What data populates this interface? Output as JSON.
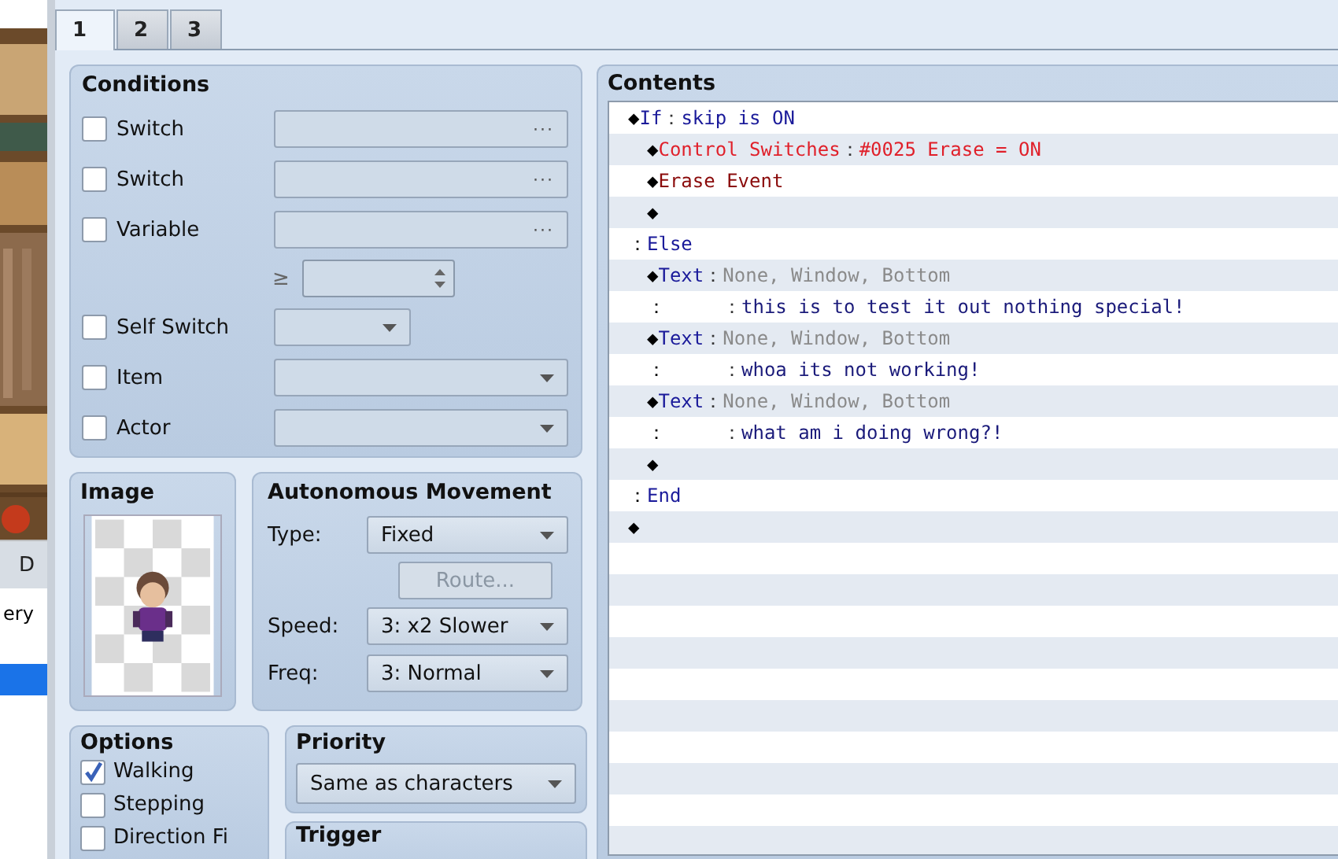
{
  "sidebar": {
    "tab_label": "D",
    "list_items": [
      {
        "label": "ery",
        "selected": false
      },
      {
        "selected": true
      }
    ]
  },
  "tabs": [
    {
      "label": "1",
      "selected": true
    },
    {
      "label": "2",
      "selected": false
    },
    {
      "label": "3",
      "selected": false
    }
  ],
  "conditions": {
    "title": "Conditions",
    "rows": [
      {
        "kind": "picker",
        "label": "Switch",
        "checked": false,
        "button": "···"
      },
      {
        "kind": "picker",
        "label": "Switch",
        "checked": false,
        "button": "···"
      },
      {
        "kind": "picker",
        "label": "Variable",
        "checked": false,
        "button": "···"
      },
      {
        "kind": "compare",
        "symbol": "≥"
      },
      {
        "kind": "short-dropdown",
        "label": "Self Switch",
        "checked": false
      },
      {
        "kind": "dropdown",
        "label": "Item",
        "checked": false
      },
      {
        "kind": "dropdown",
        "label": "Actor",
        "checked": false
      }
    ]
  },
  "image": {
    "title": "Image"
  },
  "movement": {
    "title": "Autonomous Movement",
    "fields": [
      {
        "kind": "dropdown",
        "label": "Type:",
        "value": "Fixed"
      },
      {
        "kind": "button",
        "value": "Route...",
        "disabled": true
      },
      {
        "kind": "dropdown",
        "label": "Speed:",
        "value": "3: x2 Slower"
      },
      {
        "kind": "dropdown",
        "label": "Freq:",
        "value": "3: Normal"
      }
    ]
  },
  "options": {
    "title": "Options",
    "items": [
      {
        "label": "Walking",
        "checked": true
      },
      {
        "label": "Stepping",
        "checked": false
      },
      {
        "label": "Direction Fi",
        "checked": false
      }
    ]
  },
  "priority": {
    "title": "Priority",
    "value": "Same as characters"
  },
  "trigger": {
    "title": "Trigger"
  },
  "contents": {
    "title": "Contents",
    "rows": [
      {
        "marker": "◆",
        "segments": [
          {
            "kind": "command",
            "text": "If"
          },
          {
            "kind": "sep",
            "text": "："
          },
          {
            "kind": "command",
            "text": "skip is ON"
          }
        ],
        "children": [
          {
            "marker": "◆",
            "segments": [
              {
                "kind": "switch",
                "text": "Control Switches"
              },
              {
                "kind": "sep",
                "text": "："
              },
              {
                "kind": "switch",
                "text": "#0025 Erase = ON"
              }
            ]
          },
          {
            "marker": "◆",
            "segments": [
              {
                "kind": "erase",
                "text": "Erase Event"
              }
            ]
          },
          {
            "marker": "◆"
          }
        ]
      },
      {
        "marker": "：",
        "segments": [
          {
            "kind": "command",
            "text": "Else"
          }
        ],
        "children": [
          {
            "marker": "◆",
            "segments": [
              {
                "kind": "command",
                "text": "Text"
              },
              {
                "kind": "sep",
                "text": "："
              },
              {
                "kind": "param",
                "text": "None, Window, Bottom"
              }
            ]
          },
          {
            "marker": "：",
            "segments": [
              {
                "kind": "wide-sep",
                "text": "："
              },
              {
                "kind": "message",
                "text": "this is to test it out nothing special!"
              }
            ]
          },
          {
            "marker": "◆",
            "segments": [
              {
                "kind": "command",
                "text": "Text"
              },
              {
                "kind": "sep",
                "text": "："
              },
              {
                "kind": "param",
                "text": "None, Window, Bottom"
              }
            ]
          },
          {
            "marker": "：",
            "segments": [
              {
                "kind": "wide-sep",
                "text": "："
              },
              {
                "kind": "message",
                "text": "whoa its not working!"
              }
            ]
          },
          {
            "marker": "◆",
            "segments": [
              {
                "kind": "command",
                "text": "Text"
              },
              {
                "kind": "sep",
                "text": "："
              },
              {
                "kind": "param",
                "text": "None, Window, Bottom"
              }
            ]
          },
          {
            "marker": "：",
            "segments": [
              {
                "kind": "wide-sep",
                "text": "："
              },
              {
                "kind": "message",
                "text": "what am i doing wrong?!"
              }
            ]
          },
          {
            "marker": "◆"
          }
        ]
      },
      {
        "marker": "：",
        "segments": [
          {
            "kind": "command",
            "text": "End"
          }
        ]
      },
      {
        "marker": "◆"
      }
    ]
  }
}
